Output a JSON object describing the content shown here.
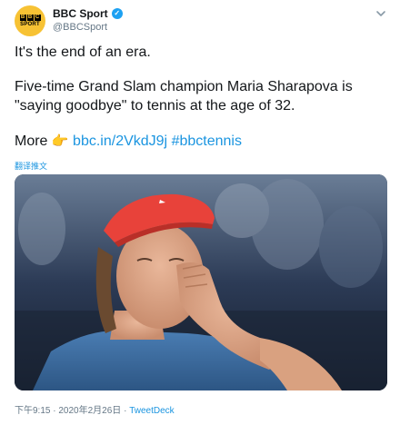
{
  "account": {
    "display_name": "BBC Sport",
    "handle": "@BBCSport",
    "avatar_logo_letters": [
      "B",
      "B",
      "C"
    ],
    "avatar_logo_word": "SPORT",
    "verified_mark": "✓"
  },
  "tweet": {
    "line1": "It's the end of an era.",
    "line2": "Five-time Grand Slam champion Maria Sharapova is \"saying goodbye\" to tennis at the age of 32.",
    "more_label": "More",
    "emoji": "👉",
    "link": "bbc.in/2VkdJ9j",
    "hashtag": "#bbctennis"
  },
  "translate_label": "翻译推文",
  "media": {
    "alt": "Tennis player in a red visor blowing a kiss"
  },
  "footer": {
    "timestamp": "下午9:15 · 2020年2月26日",
    "separator": "·",
    "source": "TweetDeck"
  },
  "colors": {
    "link": "#1b95e0",
    "avatar_bg": "#f7c234",
    "verified": "#1da1f2",
    "visor": "#e8423a"
  }
}
